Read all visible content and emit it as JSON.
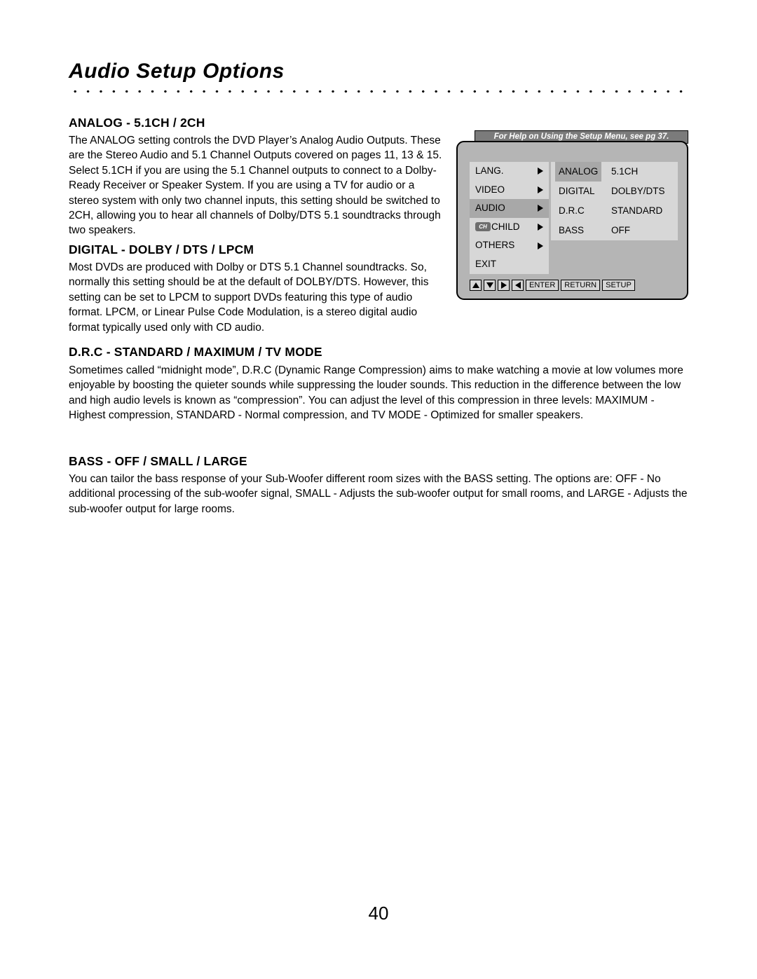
{
  "page": {
    "title": "Audio Setup Options",
    "number": "40"
  },
  "sections": [
    {
      "heading": "ANALOG - 5.1CH / 2CH",
      "body": "The ANALOG setting controls the DVD Player’s Analog Audio Outputs. These are the Stereo Audio and 5.1 Channel Outputs covered on pages 11, 13 & 15. Select 5.1CH if you are using the 5.1 Channel outputs to connect to a Dolby-Ready Receiver or Speaker System. If you are using a TV for audio or a stereo system with only two channel inputs, this setting should be switched to 2CH, allowing you to hear all channels of Dolby/DTS 5.1 soundtracks through two speakers."
    },
    {
      "heading": "DIGITAL - DOLBY / DTS / LPCM",
      "body": "Most DVDs are produced with Dolby or DTS 5.1 Channel soundtracks. So, normally this setting should be at the default of DOLBY/DTS. However, this setting can be set to LPCM to support DVDs featuring this type of audio format. LPCM, or Linear Pulse Code Modulation, is a stereo digital audio format typically used only with CD audio."
    },
    {
      "heading": "D.R.C - STANDARD / MAXIMUM / TV MODE",
      "body": "Sometimes called “midnight mode”, D.R.C (Dynamic Range Compression) aims to make watching a movie at low volumes more enjoyable by boosting the quieter sounds while suppressing the louder sounds. This reduction in the difference between the low and high audio levels is known as “compression”. You can adjust the level of this compression in three levels: MAXIMUM - Highest compression, STANDARD - Normal compression, and TV MODE - Optimized for smaller speakers."
    },
    {
      "heading": "BASS - OFF / SMALL / LARGE",
      "body": "You can tailor the bass response of your Sub-Woofer different room sizes with the BASS setting. The options are: OFF - No additional processing of the sub-woofer signal, SMALL - Adjusts the sub-woofer output for small rooms, and LARGE - Adjusts the sub-woofer output for large rooms."
    }
  ],
  "menu_graphic": {
    "help_banner": "For Help on Using the Setup Menu, see pg 37.",
    "left_menu": [
      {
        "label": "LANG.",
        "selected": false,
        "arrow": true,
        "icon": null
      },
      {
        "label": "VIDEO",
        "selected": false,
        "arrow": true,
        "icon": null
      },
      {
        "label": "AUDIO",
        "selected": true,
        "arrow": true,
        "icon": null
      },
      {
        "label": "CHILD",
        "selected": false,
        "arrow": true,
        "icon": "lock-icon"
      },
      {
        "label": "OTHERS",
        "selected": false,
        "arrow": true,
        "icon": null
      },
      {
        "label": "EXIT",
        "selected": false,
        "arrow": false,
        "icon": null
      }
    ],
    "right_menu": [
      {
        "label": "ANALOG",
        "value": "5.1CH",
        "highlight": true
      },
      {
        "label": "DIGITAL",
        "value": "DOLBY/DTS",
        "highlight": false
      },
      {
        "label": "D.R.C",
        "value": "STANDARD",
        "highlight": false
      },
      {
        "label": "BASS",
        "value": "OFF",
        "highlight": false
      }
    ],
    "keys": [
      {
        "type": "arrow",
        "glyph": "up"
      },
      {
        "type": "arrow",
        "glyph": "down"
      },
      {
        "type": "arrow",
        "glyph": "right"
      },
      {
        "type": "arrow",
        "glyph": "left"
      },
      {
        "type": "text",
        "label": "ENTER"
      },
      {
        "type": "text",
        "label": "RETURN"
      },
      {
        "type": "text",
        "label": "SETUP"
      }
    ],
    "child_icon_text": "CH"
  }
}
